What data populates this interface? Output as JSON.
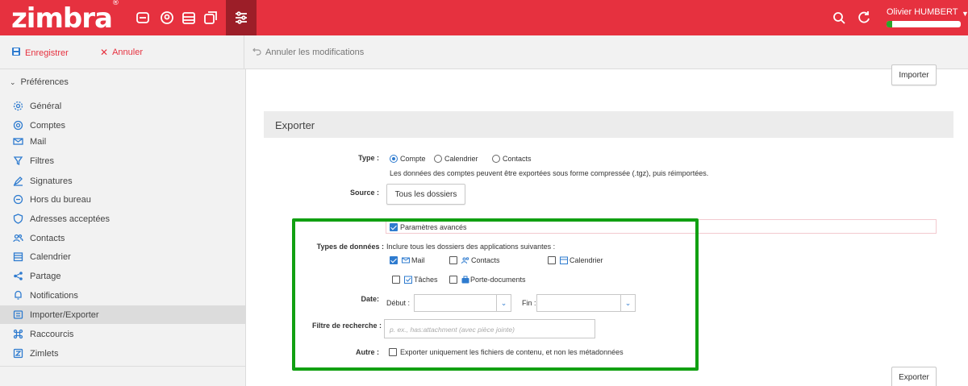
{
  "app": {
    "logo": "zimbra",
    "user_name": "Olivier HUMBERT",
    "quota_fraction": 0.08,
    "accent_color": "#e6313f",
    "link_color": "#2e7bcf",
    "apps": [
      "mail-icon",
      "contacts-icon",
      "calendar-icon",
      "tasks-icon",
      "preferences-icon"
    ]
  },
  "toolbar": {
    "save_label": "Enregistrer",
    "cancel_label": "Annuler",
    "undo_label": "Annuler les modifications"
  },
  "sidebar": {
    "header": "Préférences",
    "items": [
      {
        "label": "Général",
        "icon": "gear-icon"
      },
      {
        "label": "Comptes",
        "icon": "at-icon"
      },
      {
        "label": "Mail",
        "icon": "mail-icon"
      },
      {
        "label": "Filtres",
        "icon": "filter-icon"
      },
      {
        "label": "Signatures",
        "icon": "pen-icon"
      },
      {
        "label": "Hors du bureau",
        "icon": "out-of-office-icon"
      },
      {
        "label": "Adresses acceptées",
        "icon": "shield-icon"
      },
      {
        "label": "Contacts",
        "icon": "contacts-icon"
      },
      {
        "label": "Calendrier",
        "icon": "calendar-icon"
      },
      {
        "label": "Partage",
        "icon": "share-icon"
      },
      {
        "label": "Notifications",
        "icon": "bell-icon"
      },
      {
        "label": "Importer/Exporter",
        "icon": "import-export-icon",
        "selected": true
      },
      {
        "label": "Raccourcis",
        "icon": "command-icon"
      },
      {
        "label": "Zimlets",
        "icon": "zimlet-icon"
      }
    ]
  },
  "import": {
    "button": "Importer"
  },
  "export": {
    "title": "Exporter",
    "type_label": "Type :",
    "type_options": [
      "Compte",
      "Calendrier",
      "Contacts"
    ],
    "type_selected": "Compte",
    "type_description": "Les données des comptes peuvent être exportées sous forme compressée (.tgz), puis réimportées.",
    "source_label": "Source :",
    "source_button": "Tous les dossiers",
    "advanced_label": "Paramètres avancés",
    "advanced_checked": true,
    "data_types_label": "Types de données :",
    "data_types_description": "Inclure tous les dossiers des applications suivantes :",
    "data_types": [
      {
        "label": "Mail",
        "checked": true,
        "icon": "mail-icon"
      },
      {
        "label": "Contacts",
        "checked": false,
        "icon": "contacts-icon"
      },
      {
        "label": "Calendrier",
        "checked": false,
        "icon": "calendar-icon"
      },
      {
        "label": "Tâches",
        "checked": false,
        "icon": "tasks-icon"
      },
      {
        "label": "Porte-documents",
        "checked": false,
        "icon": "briefcase-icon"
      }
    ],
    "date_label": "Date:",
    "start_label": "Début :",
    "end_label": "Fin :",
    "filter_label": "Filtre de recherche :",
    "filter_placeholder": "p. ex., has:attachment (avec pièce jointe)",
    "other_label": "Autre :",
    "other_option": "Exporter uniquement les fichiers de contenu, et non les métadonnées",
    "other_checked": false,
    "export_button": "Exporter"
  }
}
